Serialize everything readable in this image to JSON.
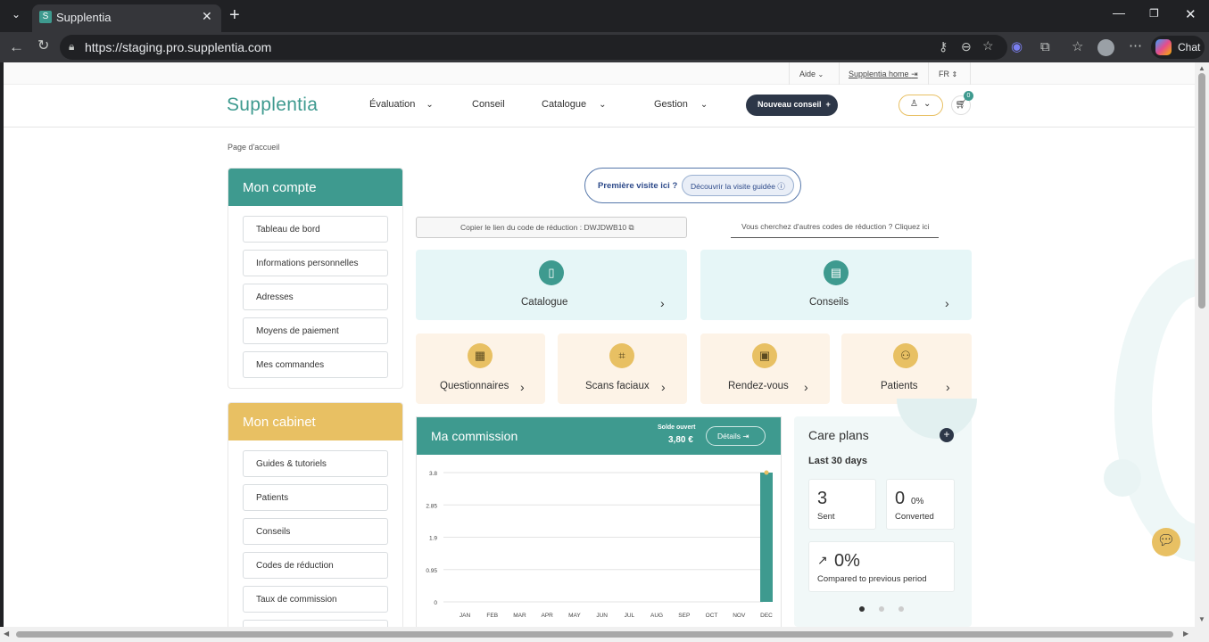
{
  "browser": {
    "tab_title": "Supplentia",
    "tab_favicon": "S",
    "url": "https://staging.pro.supplentia.com",
    "chat_label": "Chat"
  },
  "util": {
    "help": "Aide",
    "home": "Supplentia home",
    "lang": "FR"
  },
  "nav": {
    "logo": "Supplentia",
    "items": [
      "Évaluation",
      "Conseil",
      "Catalogue",
      "Gestion"
    ],
    "cta": "Nouveau conseil",
    "cart_count": "0"
  },
  "breadcrumb": "Page d'accueil",
  "account": {
    "title": "Mon compte",
    "items": [
      "Tableau de bord",
      "Informations personnelles",
      "Adresses",
      "Moyens de paiement",
      "Mes commandes"
    ]
  },
  "cabinet": {
    "title": "Mon cabinet",
    "items": [
      "Guides & tutoriels",
      "Patients",
      "Conseils",
      "Codes de réduction",
      "Taux de commission"
    ]
  },
  "tour": {
    "question": "Première visite ici ?",
    "button": "Découvrir la visite guidée"
  },
  "promo": {
    "copy": "Copier le lien du code de réduction : DWJDWB10",
    "other": "Vous cherchez d'autres codes de réduction ? Cliquez ici"
  },
  "tiles": {
    "catalogue": "Catalogue",
    "conseils": "Conseils",
    "questionnaires": "Questionnaires",
    "scans": "Scans faciaux",
    "rdv": "Rendez-vous",
    "patients": "Patients"
  },
  "commission": {
    "title": "Ma commission",
    "balance_label": "Solde ouvert",
    "balance": "3,80 €",
    "details": "Détails"
  },
  "chart_data": {
    "type": "bar",
    "categories": [
      "JAN",
      "FEB",
      "MAR",
      "APR",
      "MAY",
      "JUN",
      "JUL",
      "AUG",
      "SEP",
      "OCT",
      "NOV",
      "DEC"
    ],
    "values": [
      0,
      0,
      0,
      0,
      0,
      0,
      0,
      0,
      0,
      0,
      0,
      3.8
    ],
    "yticks": [
      "3.8",
      "2.85",
      "1.9",
      "0.95",
      "0"
    ],
    "ylim": [
      0,
      3.8
    ],
    "bar_color": "#3e9a8f",
    "grid": true
  },
  "care": {
    "title": "Care plans",
    "period": "Last 30 days",
    "sent_value": "3",
    "sent_label": "Sent",
    "conv_value": "0",
    "conv_pct": "0%",
    "conv_label": "Converted",
    "trend_value": "0%",
    "trend_label": "Compared to previous period"
  },
  "colors": {
    "teal": "#3e9a8f",
    "gold": "#e8c063",
    "navy": "#2d3748",
    "tile_blue": "#e6f6f7",
    "tile_peach": "#fdf3e7"
  }
}
